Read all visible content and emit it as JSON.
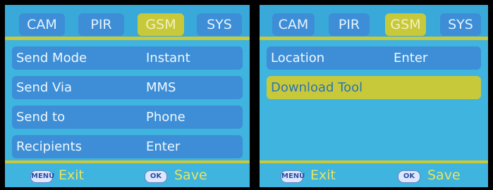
{
  "left_screen": {
    "tabs": [
      {
        "label": "CAM",
        "active": false
      },
      {
        "label": "PIR",
        "active": false
      },
      {
        "label": "GSM",
        "active": true
      },
      {
        "label": "SYS",
        "active": false
      }
    ],
    "rows": [
      {
        "label": "Send Mode",
        "value": "Instant"
      },
      {
        "label": "Send Via",
        "value": "MMS"
      },
      {
        "label": "Send to",
        "value": "Phone"
      },
      {
        "label": "Recipients",
        "value": "Enter"
      }
    ],
    "footer": {
      "menu_key": "MENU",
      "exit_label": "Exit",
      "ok_key": "OK",
      "save_label": "Save"
    }
  },
  "right_screen": {
    "tabs": [
      {
        "label": "CAM",
        "active": false
      },
      {
        "label": "PIR",
        "active": false
      },
      {
        "label": "GSM",
        "active": true
      },
      {
        "label": "SYS",
        "active": false
      }
    ],
    "rows": [
      {
        "label": "Location",
        "value": "Enter",
        "selected": false
      },
      {
        "label": "Download Tool",
        "value": "",
        "selected": true
      }
    ],
    "footer": {
      "menu_key": "MENU",
      "exit_label": "Exit",
      "ok_key": "OK",
      "save_label": "Save"
    }
  },
  "colors": {
    "screen_bg": "#3fb4de",
    "row_bg": "#3d8ed6",
    "selected_bg": "#c8c93a",
    "footer_text": "#e4e464"
  }
}
